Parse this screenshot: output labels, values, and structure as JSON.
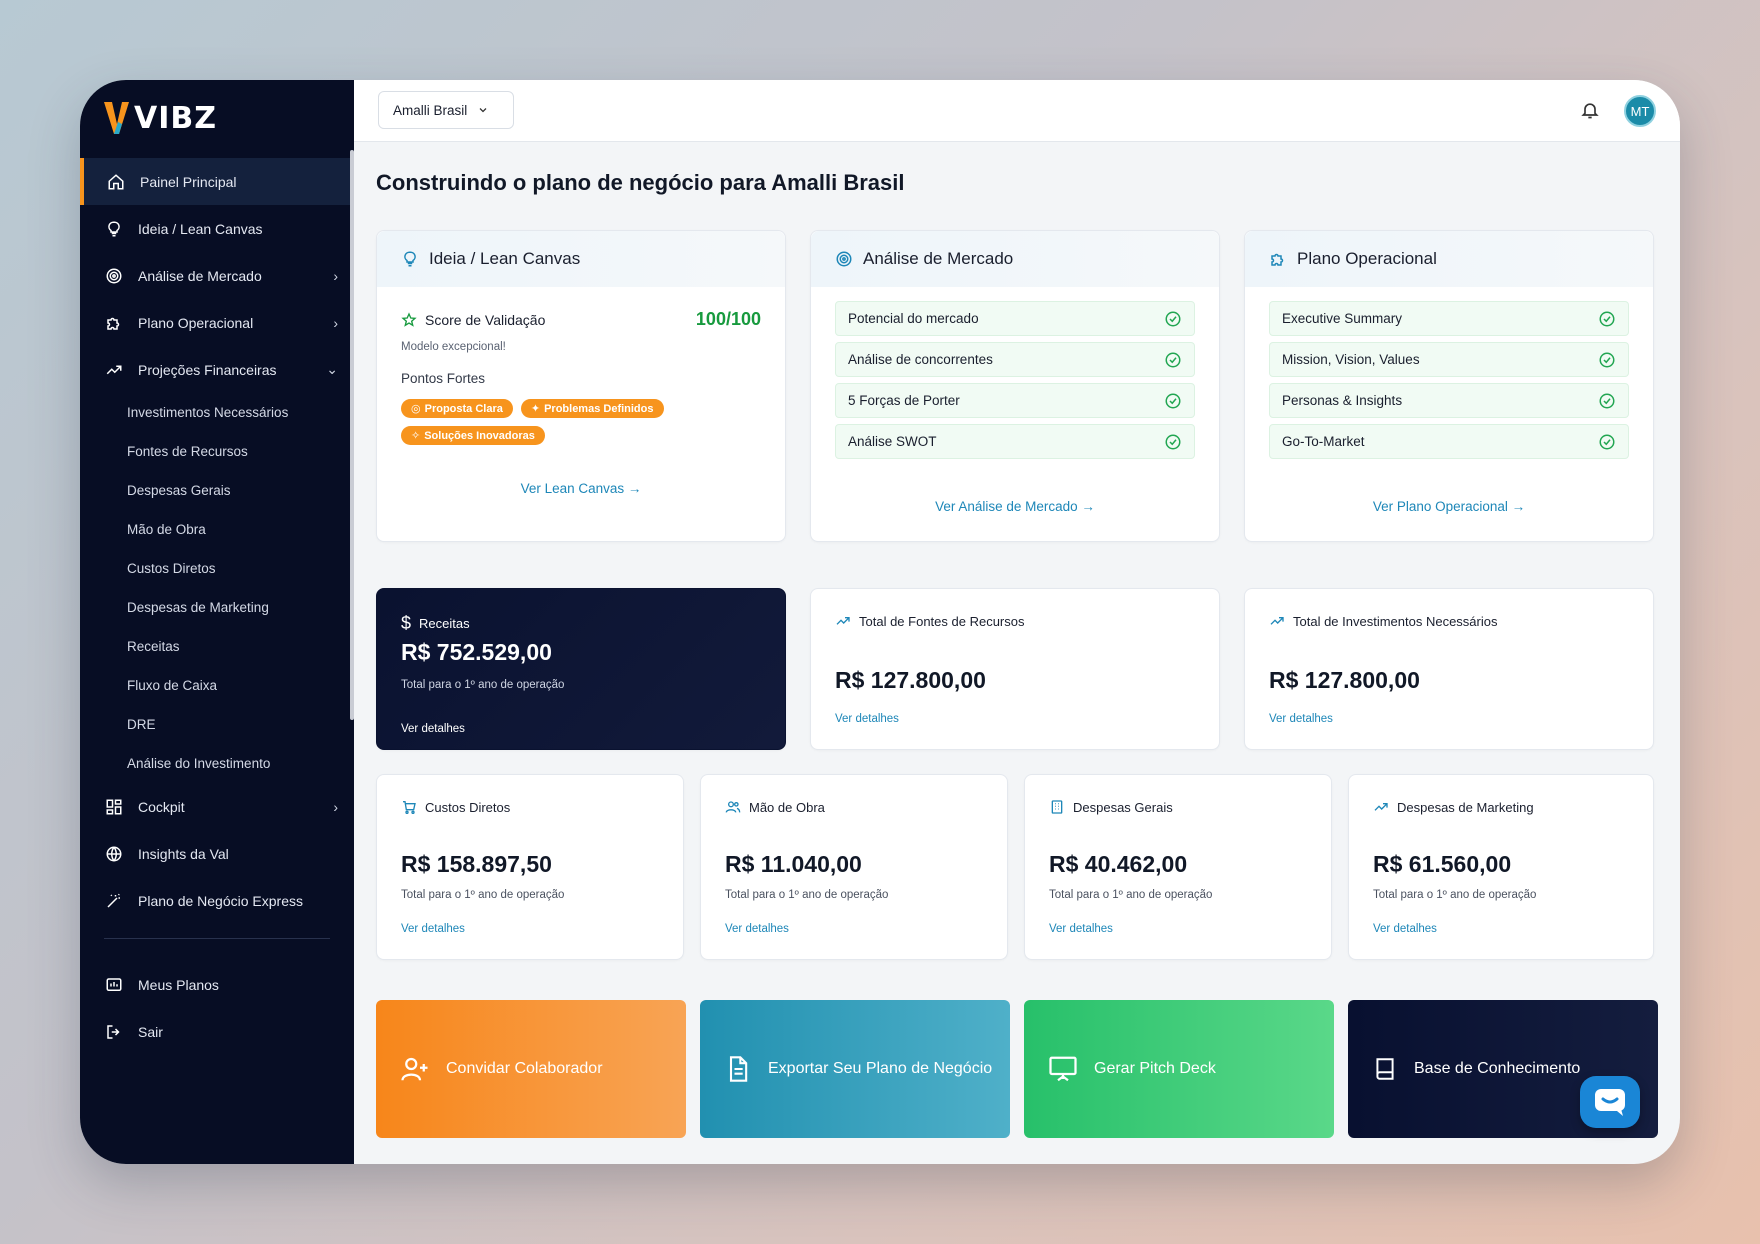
{
  "brand": {
    "name": "VIBZ",
    "accent": "#f7941d",
    "sidebar_bg": "#070d24"
  },
  "sidebar": {
    "items": [
      {
        "label": "Painel Principal",
        "icon": "home-icon",
        "active": true
      },
      {
        "label": "Ideia / Lean Canvas",
        "icon": "lightbulb-icon"
      },
      {
        "label": "Análise de Mercado",
        "icon": "target-icon",
        "chevron": "right"
      },
      {
        "label": "Plano Operacional",
        "icon": "puzzle-icon",
        "chevron": "right"
      },
      {
        "label": "Projeções Financeiras",
        "icon": "trending-up-icon",
        "chevron": "down"
      }
    ],
    "sub_items": [
      "Investimentos Necessários",
      "Fontes de Recursos",
      "Despesas Gerais",
      "Mão de Obra",
      "Custos Diretos",
      "Despesas de Marketing",
      "Receitas",
      "Fluxo de Caixa",
      "DRE",
      "Análise do Investimento"
    ],
    "items_after": [
      {
        "label": "Cockpit",
        "icon": "dashboard-icon",
        "chevron": "right"
      },
      {
        "label": "Insights da Val",
        "icon": "globe-icon"
      },
      {
        "label": "Plano de Negócio Express",
        "icon": "magic-wand-icon"
      }
    ],
    "footer_items": [
      {
        "label": "Meus Planos",
        "icon": "presentation-icon"
      },
      {
        "label": "Sair",
        "icon": "logout-icon"
      }
    ]
  },
  "topbar": {
    "company": "Amalli Brasil",
    "avatar_initials": "MT"
  },
  "page_title": "Construindo o plano de negócio para Amalli Brasil",
  "lean_card": {
    "title": "Ideia / Lean Canvas",
    "score_label": "Score de Validação",
    "score_value": "100/100",
    "score_note": "Modelo excepcional!",
    "strengths_label": "Pontos Fortes",
    "tags": [
      "Proposta Clara",
      "Problemas Definidos",
      "Soluções Inovadoras"
    ],
    "link": "Ver Lean Canvas →"
  },
  "market_card": {
    "title": "Análise de Mercado",
    "items": [
      "Potencial do mercado",
      "Análise de concorrentes",
      "5 Forças de Porter",
      "Análise SWOT"
    ],
    "link": "Ver Análise de Mercado →"
  },
  "ops_card": {
    "title": "Plano Operacional",
    "items": [
      "Executive Summary",
      "Mission, Vision, Values",
      "Personas & Insights",
      "Go-To-Market"
    ],
    "link": "Ver Plano Operacional →"
  },
  "stats_top": [
    {
      "title": "Receitas",
      "value": "R$ 752.529,00",
      "note": "Total para o 1º ano de operação",
      "link": "Ver detalhes"
    },
    {
      "title": "Total de Fontes de Recursos",
      "value": "R$ 127.800,00",
      "link": "Ver detalhes"
    },
    {
      "title": "Total de Investimentos Necessários",
      "value": "R$ 127.800,00",
      "link": "Ver detalhes"
    }
  ],
  "stats_bottom": [
    {
      "title": "Custos Diretos",
      "value": "R$ 158.897,50",
      "note": "Total para o 1º ano de operação",
      "link": "Ver detalhes"
    },
    {
      "title": "Mão de Obra",
      "value": "R$ 11.040,00",
      "note": "Total para o 1º ano de operação",
      "link": "Ver detalhes"
    },
    {
      "title": "Despesas Gerais",
      "value": "R$ 40.462,00",
      "note": "Total para o 1º ano de operação",
      "link": "Ver detalhes"
    },
    {
      "title": "Despesas de Marketing",
      "value": "R$ 61.560,00",
      "note": "Total para o 1º ano de operação",
      "link": "Ver detalhes"
    }
  ],
  "actions": [
    {
      "label": "Convidar Colaborador",
      "icon": "user-plus-icon"
    },
    {
      "label": "Exportar Seu Plano de Negócio",
      "icon": "document-icon"
    },
    {
      "label": "Gerar Pitch Deck",
      "icon": "presentation-screen-icon"
    },
    {
      "label": "Base de Conhecimento",
      "icon": "book-icon"
    }
  ]
}
